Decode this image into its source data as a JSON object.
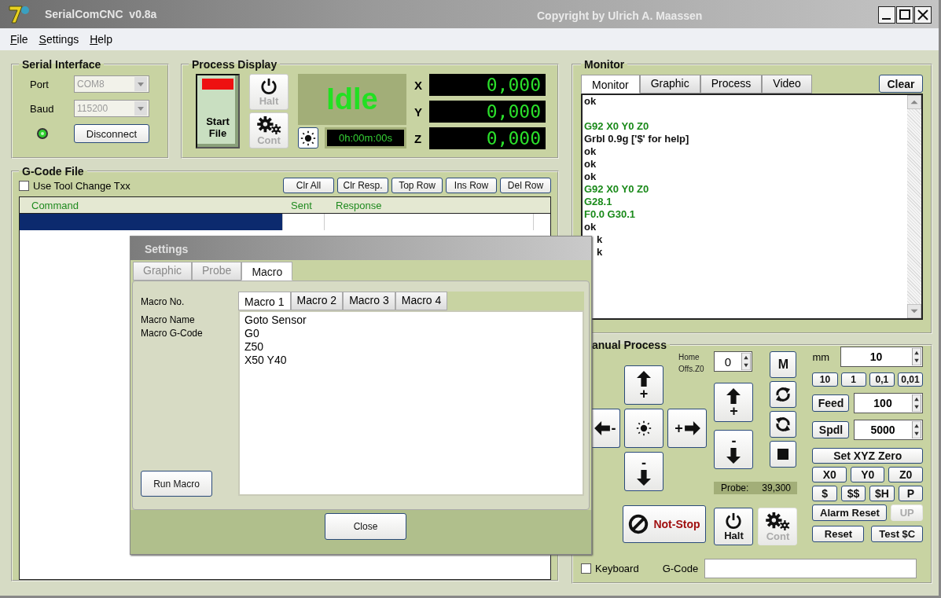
{
  "window": {
    "title": "SerialComCNC  v0.8a",
    "copyright": "Copyright by Ulrich A. Maassen"
  },
  "menu": [
    "File",
    "Settings",
    "Help"
  ],
  "serial_interface": {
    "title": "Serial Interface",
    "port": {
      "label": "Port",
      "value": "COM8",
      "disabled": true
    },
    "baud": {
      "label": "Baud",
      "value": "115200",
      "disabled": true
    },
    "connected": true,
    "disconnect_button": "Disconnect"
  },
  "process_display": {
    "title": "Process Display",
    "start_button": "Start File",
    "halt": {
      "label": "Halt",
      "disabled": true
    },
    "cont": {
      "label": "Cont",
      "disabled": true
    },
    "status": "Idle",
    "timer": "0h:00m:00s",
    "axes": [
      {
        "label": "X",
        "value": "0,000"
      },
      {
        "label": "Y",
        "value": "0,000"
      },
      {
        "label": "Z",
        "value": "0,000"
      }
    ]
  },
  "gcode_file": {
    "title": "G-Code File",
    "tool_change": {
      "label": "Use Tool Change Txx",
      "checked": false
    },
    "buttons": [
      "Clr All",
      "Clr Resp.",
      "Top Row",
      "Ins Row",
      "Del Row"
    ],
    "table": {
      "columns": [
        "Command",
        "Sent",
        "Response"
      ],
      "rows": [
        {
          "selected": true
        }
      ]
    }
  },
  "monitor": {
    "title": "Monitor",
    "tabs": [
      {
        "label": "Monitor",
        "selected": true
      },
      {
        "label": "Graphic",
        "selected": false
      },
      {
        "label": "Process",
        "selected": false
      },
      {
        "label": "Video",
        "selected": false
      }
    ],
    "clear_button": "Clear",
    "lines": [
      {
        "kind": "response",
        "text": "ok"
      },
      {
        "kind": "blank"
      },
      {
        "kind": "command",
        "text": "G92 X0 Y0 Z0"
      },
      {
        "kind": "response",
        "text": "Grbl 0.9g ['$' for help]"
      },
      {
        "kind": "response",
        "text": "ok"
      },
      {
        "kind": "response",
        "text": "ok"
      },
      {
        "kind": "response",
        "text": "ok"
      },
      {
        "kind": "command",
        "text": "G92 X0 Y0 Z0"
      },
      {
        "kind": "command",
        "text": "G28.1"
      },
      {
        "kind": "command",
        "text": "F0.0 G30.1"
      },
      {
        "kind": "response",
        "text": "ok"
      },
      {
        "kind": "response",
        "text": "k",
        "partly_hidden": true
      },
      {
        "kind": "response",
        "text": "k",
        "partly_hidden": true
      }
    ]
  },
  "manual_process": {
    "title": "anual Process",
    "home_offset": {
      "label": "Home Offs.Z0",
      "value": "0"
    },
    "jog": [
      {
        "kind": "up",
        "sign": "+"
      },
      {
        "kind": "left",
        "sign": "-"
      },
      {
        "kind": "center"
      },
      {
        "kind": "right",
        "sign": "+"
      },
      {
        "kind": "down",
        "sign": "-"
      }
    ],
    "z_jog": [
      {
        "kind": "up",
        "sign": "+"
      },
      {
        "kind": "down",
        "sign": "-"
      }
    ],
    "m_button": "M",
    "probe_label": "Probe:",
    "probe_value": "39,300",
    "not_stop": "Not-Stop",
    "halt": {
      "label": "Halt",
      "disabled": false
    },
    "cont": {
      "label": "Cont",
      "disabled": true
    },
    "mm_label": "mm",
    "mm_value": "10",
    "steps": [
      "10",
      "1",
      "0,1",
      "0,01"
    ],
    "feed": {
      "label": "Feed",
      "value": "100"
    },
    "spindle": {
      "label": "Spdl",
      "value": "5000"
    },
    "set_zero": "Set XYZ Zero",
    "zero_buttons": [
      "X0",
      "Y0",
      "Z0"
    ],
    "command_buttons": [
      "$",
      "$$",
      "$H",
      "P"
    ],
    "alarm_reset": "Alarm Reset",
    "up": {
      "label": "UP",
      "disabled": true
    },
    "reset": "Reset",
    "test": "Test $C",
    "keyboard": {
      "label": "Keyboard",
      "checked": false
    },
    "gcode_label": "G-Code"
  },
  "settings_dialog": {
    "title": "Settings",
    "tabs": [
      {
        "label": "Graphic",
        "selected": false
      },
      {
        "label": "Probe",
        "selected": false
      },
      {
        "label": "Macro",
        "selected": true
      }
    ],
    "labels": [
      "Macro No.",
      "Macro Name",
      "Macro G-Code"
    ],
    "macro_tabs": [
      {
        "label": "Macro 1",
        "selected": true
      },
      {
        "label": "Macro 2",
        "selected": false
      },
      {
        "label": "Macro 3",
        "selected": false
      },
      {
        "label": "Macro 4",
        "selected": false
      }
    ],
    "macro_lines": [
      "Goto Sensor",
      "G0",
      "Z50",
      "X50 Y40"
    ],
    "run_button": "Run Macro",
    "close_button": "Close"
  }
}
